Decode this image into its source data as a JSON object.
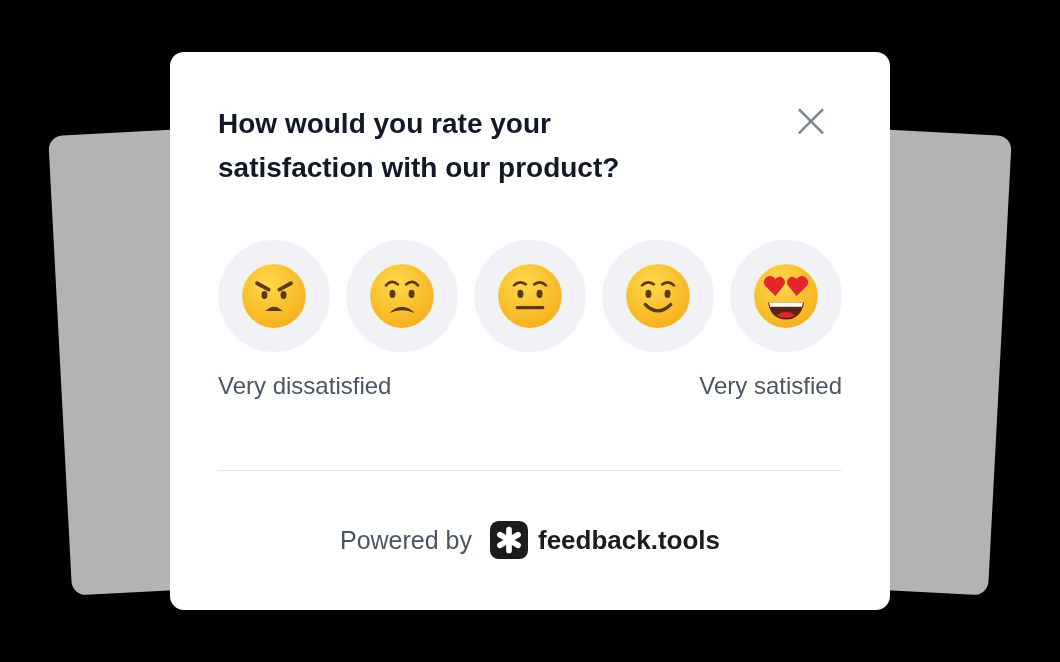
{
  "dialog": {
    "title": "How would you rate your satisfaction with our product?",
    "close_icon": "×"
  },
  "ratings": [
    {
      "kind": "angry"
    },
    {
      "kind": "worried"
    },
    {
      "kind": "neutral"
    },
    {
      "kind": "smile"
    },
    {
      "kind": "heart-eyes"
    }
  ],
  "scale_labels": {
    "low": "Very dissatisfied",
    "high": "Very satisfied"
  },
  "footer": {
    "prefix": "Powered by",
    "brand": "feedback.tools"
  }
}
